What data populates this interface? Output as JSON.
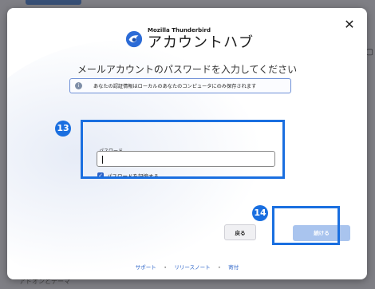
{
  "background": {
    "bottom_text": "アドオンとテーマ"
  },
  "dialog": {
    "brand_app_name": "Mozilla Thunderbird",
    "brand_title": "アカウントハブ",
    "heading": "メールアカウントのパスワードを入力してください",
    "info_text": "あなたの認証情報はローカルのあなたのコンピュータにのみ保存されます",
    "password_label": "パスワード",
    "password_value": "",
    "remember_label": "パスワードを記憶する",
    "remember_checked": true,
    "back_label": "戻る",
    "continue_label": "続ける",
    "footer": {
      "support": "サポート",
      "release_notes": "リリースノート",
      "donate": "寄付",
      "separator": "・"
    }
  },
  "annotations": {
    "badge_13": "13",
    "badge_14": "14"
  },
  "colors": {
    "accent": "#1a6fe0",
    "continue_disabled": "#a9c4ee",
    "link": "#2a62c8"
  }
}
